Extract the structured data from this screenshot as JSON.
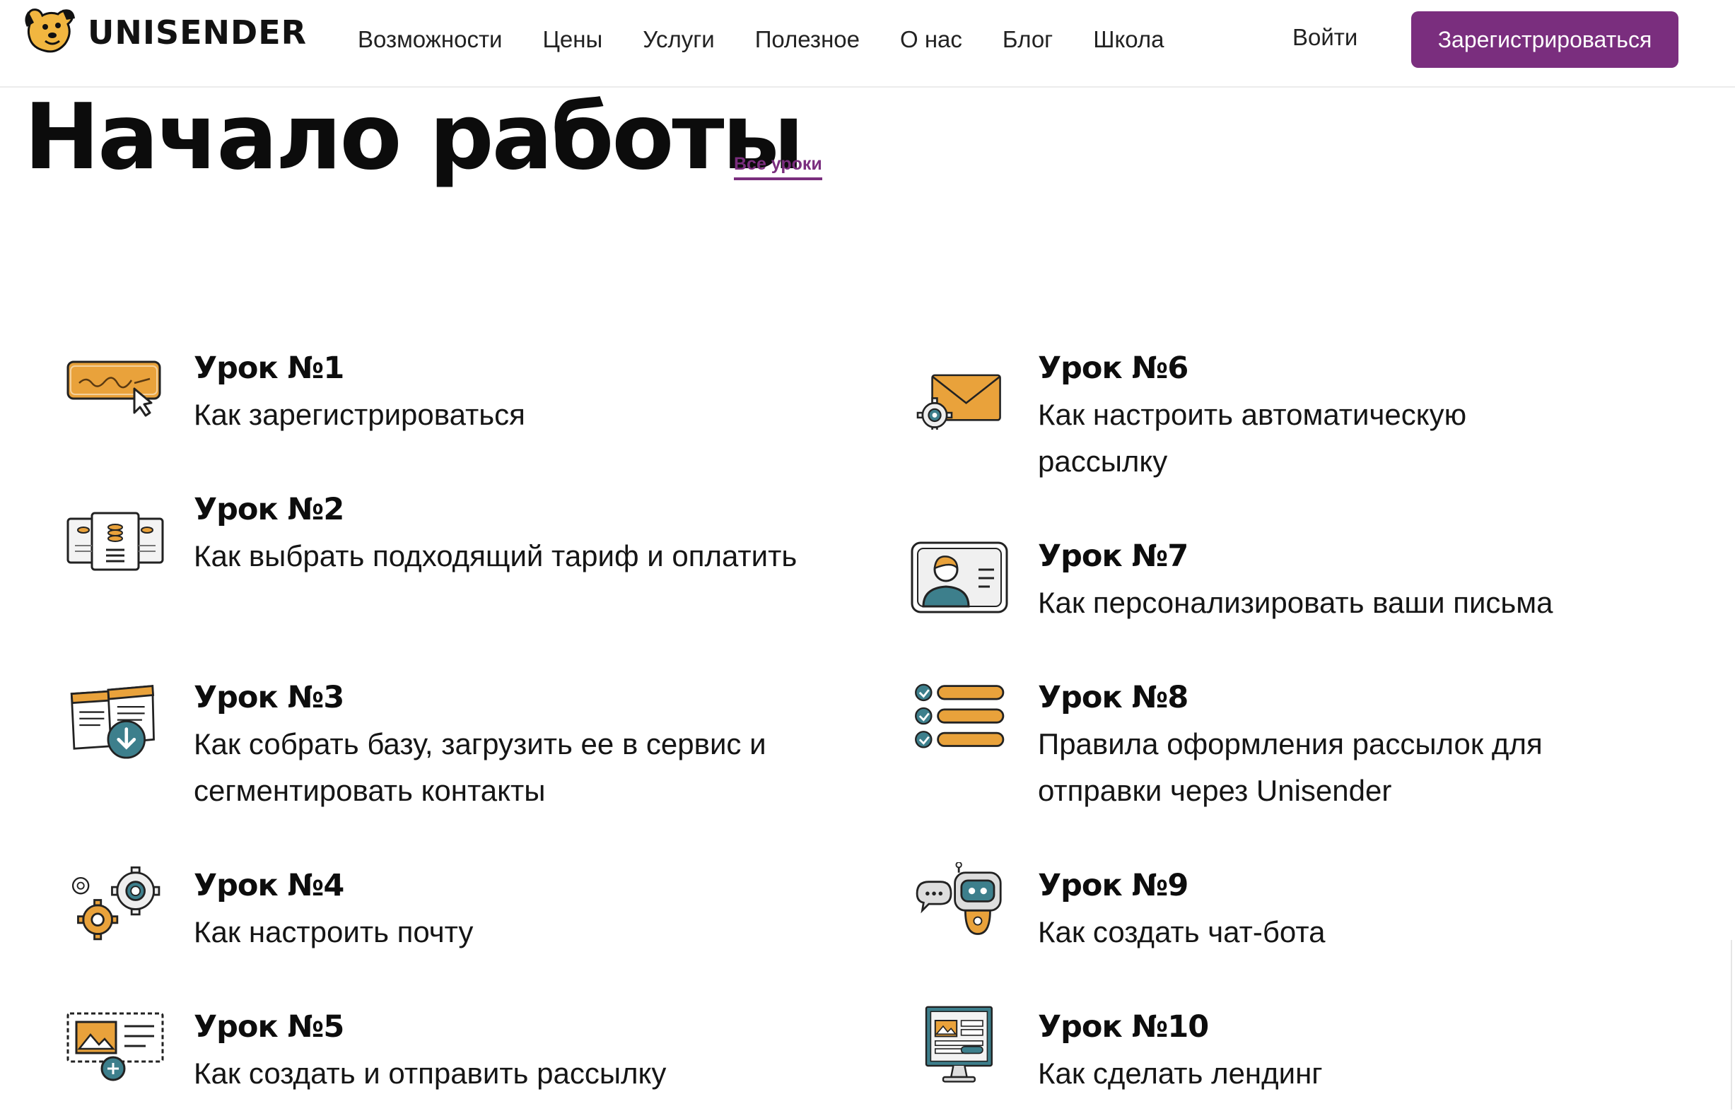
{
  "header": {
    "logo_text": "UNISENDER",
    "nav": [
      "Возможности",
      "Цены",
      "Услуги",
      "Полезное",
      "О нас",
      "Блог",
      "Школа"
    ],
    "login": "Войти",
    "signup": "Зарегистрироваться"
  },
  "page": {
    "title": "Начало работы",
    "all_lessons": "Все уроки"
  },
  "colors": {
    "accent": "#7a2e7e",
    "orange": "#e9a23b",
    "teal": "#3d7f8c"
  },
  "lessons": [
    {
      "num": "Урок №1",
      "desc": "Как зарегистрироваться",
      "icon": "signature-card-icon"
    },
    {
      "num": "Урок №2",
      "desc": "Как выбрать подходящий тариф и оплатить",
      "icon": "pricing-plans-icon"
    },
    {
      "num": "Урок №3",
      "desc": "Как собрать базу, загрузить ее в сервис и сегментировать контакты",
      "icon": "contacts-upload-icon"
    },
    {
      "num": "Урок №4",
      "desc": "Как настроить почту",
      "icon": "gears-icon"
    },
    {
      "num": "Урок №5",
      "desc": "Как создать и отправить рассылку",
      "icon": "newsletter-icon"
    },
    {
      "num": "Урок №6",
      "desc": "Как настроить автоматическую рассылку",
      "icon": "envelope-gear-icon"
    },
    {
      "num": "Урок №7",
      "desc": "Как персонализировать ваши письма",
      "icon": "profile-card-icon"
    },
    {
      "num": "Урок №8",
      "desc": "Правила оформления рассылок для отправки через Unisender",
      "icon": "checklist-icon"
    },
    {
      "num": "Урок №9",
      "desc": "Как создать чат-бота",
      "icon": "robot-icon"
    },
    {
      "num": "Урок №10",
      "desc": "Как сделать лендинг",
      "icon": "landing-monitor-icon"
    }
  ]
}
